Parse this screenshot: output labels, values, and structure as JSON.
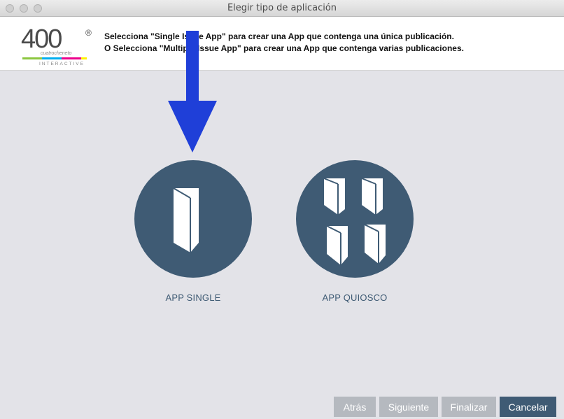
{
  "window": {
    "title": "Elegir tipo de aplicación"
  },
  "header": {
    "logo_number": "400",
    "logo_subtitle": "cuatrocheneto",
    "logo_tagline": "INTERACTIVE",
    "logo_registered": "®",
    "line1": "Selecciona \"Single Issue App\" para crear una App que contenga una única publicación.",
    "line2": "O Selecciona \"Multiple Issue App\" para crear una App que contenga varias publicaciones."
  },
  "options": {
    "single": {
      "label": "APP SINGLE",
      "icon": "single-door-icon"
    },
    "kiosk": {
      "label": "APP QUIOSCO",
      "icon": "multiple-doors-icon"
    }
  },
  "footer": {
    "back": "Atrás",
    "next": "Siguiente",
    "finish": "Finalizar",
    "cancel": "Cancelar"
  },
  "colors": {
    "accent": "#3f5b74",
    "arrow": "#1f3fd8",
    "disabled_button": "#b5b9bf",
    "background": "#e3e3e8"
  }
}
